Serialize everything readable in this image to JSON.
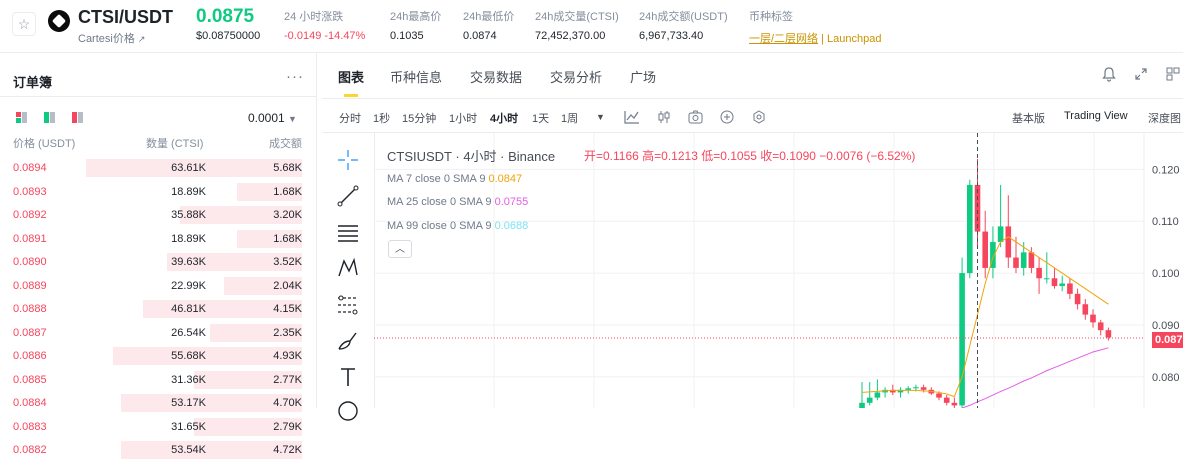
{
  "header": {
    "pair": "CTSI/USDT",
    "coin_name": "Cartesi价格",
    "last_price": "0.0875",
    "last_price_usd": "$0.08750000",
    "stats": [
      {
        "label": "24 小时涨跌",
        "value": "-0.0149 -14.47%"
      },
      {
        "label": "24h最高价",
        "value": "0.1035"
      },
      {
        "label": "24h最低价",
        "value": "0.0874"
      },
      {
        "label": "24h成交量(CTSI)",
        "value": "72,452,370.00"
      },
      {
        "label": "24h成交额(USDT)",
        "value": "6,967,733.40"
      }
    ],
    "tag_label": "币种标签",
    "tag_value": "一层/二层网络",
    "tag_extra": "Launchpad"
  },
  "orderbook": {
    "title": "订单簿",
    "more": "···",
    "precision": "0.0001",
    "col_price": "价格 (USDT)",
    "col_amount": "数量 (CTSI)",
    "col_total": "成交额",
    "rows": [
      {
        "price": "0.0894",
        "amount": "63.61K",
        "total": "5.68K",
        "depth": 0.8
      },
      {
        "price": "0.0893",
        "amount": "18.89K",
        "total": "1.68K",
        "depth": 0.24
      },
      {
        "price": "0.0892",
        "amount": "35.88K",
        "total": "3.20K",
        "depth": 0.45
      },
      {
        "price": "0.0891",
        "amount": "18.89K",
        "total": "1.68K",
        "depth": 0.24
      },
      {
        "price": "0.0890",
        "amount": "39.63K",
        "total": "3.52K",
        "depth": 0.5
      },
      {
        "price": "0.0889",
        "amount": "22.99K",
        "total": "2.04K",
        "depth": 0.29
      },
      {
        "price": "0.0888",
        "amount": "46.81K",
        "total": "4.15K",
        "depth": 0.59
      },
      {
        "price": "0.0887",
        "amount": "26.54K",
        "total": "2.35K",
        "depth": 0.34
      },
      {
        "price": "0.0886",
        "amount": "55.68K",
        "total": "4.93K",
        "depth": 0.7
      },
      {
        "price": "0.0885",
        "amount": "31.36K",
        "total": "2.77K",
        "depth": 0.4
      },
      {
        "price": "0.0884",
        "amount": "53.17K",
        "total": "4.70K",
        "depth": 0.67
      },
      {
        "price": "0.0883",
        "amount": "31.65K",
        "total": "2.79K",
        "depth": 0.4
      },
      {
        "price": "0.0882",
        "amount": "53.54K",
        "total": "4.72K",
        "depth": 0.67
      }
    ]
  },
  "chart_tabs": [
    {
      "label": "图表",
      "active": true
    },
    {
      "label": "币种信息",
      "active": false
    },
    {
      "label": "交易数据",
      "active": false
    },
    {
      "label": "交易分析",
      "active": false
    },
    {
      "label": "广场",
      "active": false
    }
  ],
  "intervals": [
    {
      "label": "分时",
      "active": false
    },
    {
      "label": "1秒",
      "active": false
    },
    {
      "label": "15分钟",
      "active": false
    },
    {
      "label": "1小时",
      "active": false
    },
    {
      "label": "4小时",
      "active": true
    },
    {
      "label": "1天",
      "active": false
    },
    {
      "label": "1周",
      "active": false
    }
  ],
  "views": [
    {
      "label": "基本版",
      "active": false
    },
    {
      "label": "Trading View",
      "active": true
    },
    {
      "label": "深度图",
      "active": false
    }
  ],
  "legend": {
    "symbol": "CTSIUSDT · 4小时 · Binance",
    "ohlc": "开=0.1166  高=0.1213  低=0.1055  收=0.1090  −0.0076 (−6.52%)",
    "ma7_label": "MA 7 close 0 SMA 9",
    "ma7_value": "0.0847",
    "ma25_label": "MA 25 close 0 SMA 9",
    "ma25_value": "0.0755",
    "ma99_label": "MA 99 close 0 SMA 9",
    "ma99_value": "0.0688"
  },
  "colors": {
    "up": "#0ecb81",
    "down": "#f6465d",
    "ma7": "#f0a30a",
    "ma25": "#e45de8",
    "ma99": "#7de3f0"
  },
  "chart_data": {
    "type": "candlestick",
    "y_axis": {
      "ticks": [
        "0.120",
        "0.110",
        "0.100",
        "0.090",
        "0.080"
      ],
      "ylim": [
        0.074,
        0.127
      ]
    },
    "current_price": "0.087",
    "candles": [
      {
        "o": 0.074,
        "h": 0.079,
        "l": 0.074,
        "c": 0.075
      },
      {
        "o": 0.075,
        "h": 0.079,
        "l": 0.0745,
        "c": 0.076
      },
      {
        "o": 0.076,
        "h": 0.0795,
        "l": 0.0755,
        "c": 0.077
      },
      {
        "o": 0.077,
        "h": 0.078,
        "l": 0.076,
        "c": 0.0775
      },
      {
        "o": 0.0775,
        "h": 0.0785,
        "l": 0.0765,
        "c": 0.077
      },
      {
        "o": 0.077,
        "h": 0.078,
        "l": 0.076,
        "c": 0.0775
      },
      {
        "o": 0.0775,
        "h": 0.0782,
        "l": 0.0768,
        "c": 0.0778
      },
      {
        "o": 0.0778,
        "h": 0.0785,
        "l": 0.0772,
        "c": 0.078
      },
      {
        "o": 0.078,
        "h": 0.0785,
        "l": 0.077,
        "c": 0.0775
      },
      {
        "o": 0.0775,
        "h": 0.078,
        "l": 0.0765,
        "c": 0.0768
      },
      {
        "o": 0.0768,
        "h": 0.0772,
        "l": 0.0755,
        "c": 0.076
      },
      {
        "o": 0.076,
        "h": 0.0765,
        "l": 0.0745,
        "c": 0.075
      },
      {
        "o": 0.075,
        "h": 0.076,
        "l": 0.074,
        "c": 0.0745
      },
      {
        "o": 0.0745,
        "h": 0.103,
        "l": 0.074,
        "c": 0.1
      },
      {
        "o": 0.1,
        "h": 0.118,
        "l": 0.099,
        "c": 0.117
      },
      {
        "o": 0.117,
        "h": 0.122,
        "l": 0.105,
        "c": 0.108
      },
      {
        "o": 0.108,
        "h": 0.112,
        "l": 0.099,
        "c": 0.101
      },
      {
        "o": 0.101,
        "h": 0.109,
        "l": 0.099,
        "c": 0.106
      },
      {
        "o": 0.106,
        "h": 0.117,
        "l": 0.105,
        "c": 0.109
      },
      {
        "o": 0.109,
        "h": 0.115,
        "l": 0.101,
        "c": 0.103
      },
      {
        "o": 0.103,
        "h": 0.107,
        "l": 0.1,
        "c": 0.101
      },
      {
        "o": 0.101,
        "h": 0.106,
        "l": 0.0995,
        "c": 0.104
      },
      {
        "o": 0.104,
        "h": 0.105,
        "l": 0.1,
        "c": 0.101
      },
      {
        "o": 0.101,
        "h": 0.103,
        "l": 0.096,
        "c": 0.099
      },
      {
        "o": 0.099,
        "h": 0.104,
        "l": 0.098,
        "c": 0.099
      },
      {
        "o": 0.099,
        "h": 0.101,
        "l": 0.097,
        "c": 0.0975
      },
      {
        "o": 0.0975,
        "h": 0.0995,
        "l": 0.0965,
        "c": 0.098
      },
      {
        "o": 0.098,
        "h": 0.099,
        "l": 0.095,
        "c": 0.096
      },
      {
        "o": 0.096,
        "h": 0.097,
        "l": 0.093,
        "c": 0.094
      },
      {
        "o": 0.094,
        "h": 0.095,
        "l": 0.091,
        "c": 0.092
      },
      {
        "o": 0.092,
        "h": 0.093,
        "l": 0.0895,
        "c": 0.0905
      },
      {
        "o": 0.0905,
        "h": 0.091,
        "l": 0.088,
        "c": 0.089
      },
      {
        "o": 0.089,
        "h": 0.0895,
        "l": 0.087,
        "c": 0.0876
      }
    ],
    "ma7": [
      0.077,
      0.0771,
      0.0772,
      0.0773,
      0.0774,
      0.0774,
      0.0774,
      0.0774,
      0.0773,
      0.0772,
      0.077,
      0.0767,
      0.0762,
      0.08,
      0.086,
      0.092,
      0.098,
      0.103,
      0.106,
      0.107,
      0.106,
      0.105,
      0.104,
      0.103,
      0.102,
      0.101,
      0.1,
      0.099,
      0.098,
      0.097,
      0.096,
      0.095,
      0.094
    ],
    "ma25": [
      null,
      null,
      null,
      null,
      null,
      null,
      null,
      null,
      null,
      null,
      null,
      null,
      null,
      0.074,
      0.0745,
      0.0752,
      0.0758,
      0.0765,
      0.0772,
      0.0778,
      0.0785,
      0.0792,
      0.0798,
      0.0805,
      0.0812,
      0.0818,
      0.0824,
      0.083,
      0.0836,
      0.0842,
      0.0848,
      0.0852,
      0.0856
    ]
  }
}
